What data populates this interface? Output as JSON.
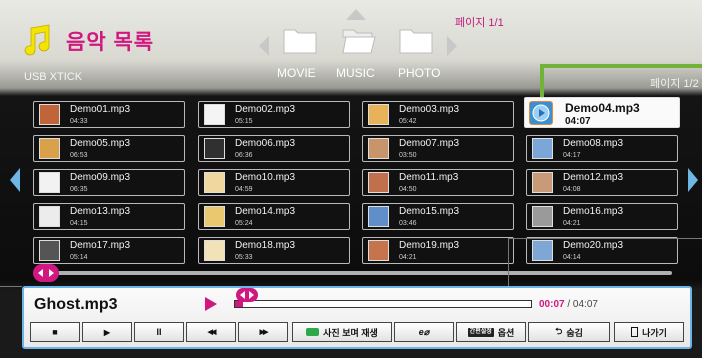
{
  "header": {
    "title": "음악 목록",
    "page_top": "페이지 1/1",
    "page_right": "페이지 1/2",
    "device": "USB XTICK",
    "categories": [
      "MOVIE",
      "MUSIC",
      "PHOTO"
    ]
  },
  "files": [
    {
      "name": "Demo01.mp3",
      "dur": "04:33",
      "thumb": "#c0643a"
    },
    {
      "name": "Demo02.mp3",
      "dur": "05:15",
      "thumb": "#f4f4f4"
    },
    {
      "name": "Demo03.mp3",
      "dur": "05:42",
      "thumb": "#e8b25a"
    },
    {
      "name": "Demo04.mp3",
      "dur": "04:07",
      "thumb": "#3d8fd0"
    },
    {
      "name": "Demo05.mp3",
      "dur": "06:53",
      "thumb": "#d9a14a"
    },
    {
      "name": "Demo06.mp3",
      "dur": "06:36",
      "thumb": "#303030"
    },
    {
      "name": "Demo07.mp3",
      "dur": "03:50",
      "thumb": "#c8946a"
    },
    {
      "name": "Demo08.mp3",
      "dur": "04:17",
      "thumb": "#7aa6d8"
    },
    {
      "name": "Demo09.mp3",
      "dur": "06:35",
      "thumb": "#f2f2f2"
    },
    {
      "name": "Demo10.mp3",
      "dur": "04:59",
      "thumb": "#f0d7a0"
    },
    {
      "name": "Demo11.mp3",
      "dur": "04:50",
      "thumb": "#c0704a"
    },
    {
      "name": "Demo12.mp3",
      "dur": "04:08",
      "thumb": "#c89a78"
    },
    {
      "name": "Demo13.mp3",
      "dur": "04:15",
      "thumb": "#ececec"
    },
    {
      "name": "Demo14.mp3",
      "dur": "05:24",
      "thumb": "#e9c870"
    },
    {
      "name": "Demo15.mp3",
      "dur": "03:46",
      "thumb": "#5f8ec8"
    },
    {
      "name": "Demo16.mp3",
      "dur": "04:21",
      "thumb": "#9a9a9a"
    },
    {
      "name": "Demo17.mp3",
      "dur": "05:14",
      "thumb": "#555555"
    },
    {
      "name": "Demo18.mp3",
      "dur": "05:33",
      "thumb": "#f1e2b8"
    },
    {
      "name": "Demo19.mp3",
      "dur": "04:21",
      "thumb": "#c6744c"
    },
    {
      "name": "Demo20.mp3",
      "dur": "04:14",
      "thumb": "#7ea7d6"
    }
  ],
  "player": {
    "title": "Ghost.mp3",
    "time_current": "00:07",
    "time_sep": " / ",
    "time_total": "04:07",
    "progress": 0.028
  },
  "controls": {
    "stop": "■",
    "play": "▶",
    "pause": "II",
    "rewind": "◀◀",
    "forward": "▶▶",
    "slideshow": "사진 보며 재생",
    "ecoIcon": "e⌀",
    "options_key": "간편설정",
    "options": "옵션",
    "back": "숨김",
    "exit": "나가기"
  },
  "colors": {
    "accent": "#d01880",
    "highlight": "#6ab4e8",
    "green": "#70b23a"
  }
}
